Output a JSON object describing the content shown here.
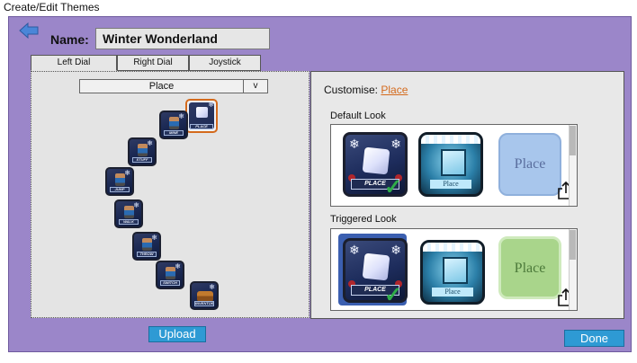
{
  "caption": "Create/Edit Themes",
  "header": {
    "name_label": "Name:",
    "name_value": "Winter Wonderland"
  },
  "tabs": [
    {
      "label": "Left Dial",
      "active": true
    },
    {
      "label": "Right Dial",
      "active": false
    },
    {
      "label": "Joystick",
      "active": false
    }
  ],
  "dial": {
    "selected_value": "Place",
    "arrow": "v",
    "buttons": [
      {
        "label": "PLACE",
        "selected": true
      },
      {
        "label": "MINE",
        "selected": false
      },
      {
        "label": "STUFF",
        "selected": false
      },
      {
        "label": "JUMP",
        "selected": false
      },
      {
        "label": "WALK",
        "selected": false
      },
      {
        "label": "THROW",
        "selected": false
      },
      {
        "label": "SWITCH",
        "selected": false
      },
      {
        "label": "INVENTORY",
        "selected": false
      }
    ]
  },
  "customise": {
    "label": "Customise:",
    "target": "Place",
    "default_title": "Default Look",
    "triggered_title": "Triggered Look",
    "default_options": [
      {
        "tag": "PLACE",
        "checked": true
      },
      {
        "tag": "Place",
        "checked": false
      },
      {
        "tag": "Place",
        "checked": false
      }
    ],
    "triggered_options": [
      {
        "tag": "PLACE",
        "checked": true
      },
      {
        "tag": "Place",
        "checked": false
      },
      {
        "tag": "Place",
        "checked": false
      }
    ]
  },
  "footer": {
    "upload_label": "Upload",
    "done_label": "Done"
  },
  "colors": {
    "background": "#9b86c9",
    "accent": "#d46a1c",
    "button": "#2e9ad4"
  }
}
